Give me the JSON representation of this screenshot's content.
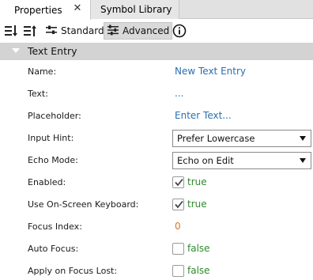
{
  "tabs": [
    {
      "label": "Properties",
      "active": true
    },
    {
      "label": "Symbol Library",
      "active": false
    }
  ],
  "toolbar": {
    "standard_label": "Standard",
    "advanced_label": "Advanced",
    "selected": "Advanced",
    "icons": [
      "sort-categorized-icon",
      "sort-alphabetical-icon",
      "standard-mode-icon",
      "advanced-mode-icon",
      "info-icon"
    ]
  },
  "section": {
    "title": "Text Entry",
    "expanded": true
  },
  "properties": [
    {
      "name": "Name:",
      "type": "link",
      "value": "New Text Entry"
    },
    {
      "name": "Text:",
      "type": "link",
      "value": "..."
    },
    {
      "name": "Placeholder:",
      "type": "link",
      "value": "Enter Text..."
    },
    {
      "name": "Input Hint:",
      "type": "select",
      "value": "Prefer Lowercase"
    },
    {
      "name": "Echo Mode:",
      "type": "select",
      "value": "Echo on Edit"
    },
    {
      "name": "Enabled:",
      "type": "checkbox",
      "checked": true,
      "value": "true"
    },
    {
      "name": "Use On-Screen Keyboard:",
      "type": "checkbox",
      "checked": true,
      "value": "true"
    },
    {
      "name": "Focus Index:",
      "type": "number",
      "value": "0"
    },
    {
      "name": "Auto Focus:",
      "type": "checkbox",
      "checked": false,
      "value": "false"
    },
    {
      "name": "Apply on Focus Lost:",
      "type": "checkbox",
      "checked": false,
      "value": "false"
    }
  ],
  "colors": {
    "link": "#2a6fb0",
    "true_false": "#2e8a2e",
    "number": "#d07a27",
    "section_bg": "#d3d3d3"
  }
}
